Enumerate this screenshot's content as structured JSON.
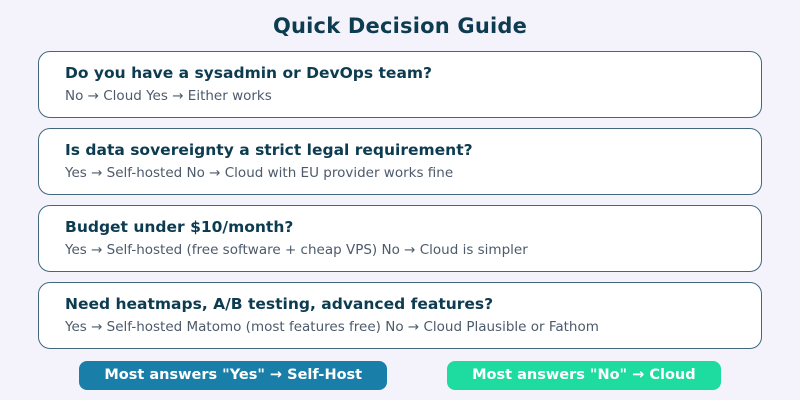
{
  "page": {
    "title": "Quick Decision Guide"
  },
  "cards": [
    {
      "question": "Do you have a sysadmin or DevOps team?",
      "answer": "No → Cloud Yes → Either works"
    },
    {
      "question": "Is data sovereignty a strict legal requirement?",
      "answer": "Yes → Self-hosted No → Cloud with EU provider works fine"
    },
    {
      "question": "Budget under $10/month?",
      "answer": "Yes → Self-hosted (free software + cheap VPS) No → Cloud is simpler"
    },
    {
      "question": "Need heatmaps, A/B testing, advanced features?",
      "answer": "Yes → Self-hosted Matomo (most features free) No → Cloud Plausible or Fathom"
    }
  ],
  "results": {
    "self_host_label": "Most answers \"Yes\" → Self-Host",
    "cloud_label": "Most answers \"No\" → Cloud"
  },
  "colors": {
    "background": "#f4f3fc",
    "card_border": "#41687c",
    "heading_text": "#0d3b50",
    "answer_text": "#4c5a6b",
    "self_host_button": "#1a7fa8",
    "cloud_button": "#1edc9f"
  }
}
